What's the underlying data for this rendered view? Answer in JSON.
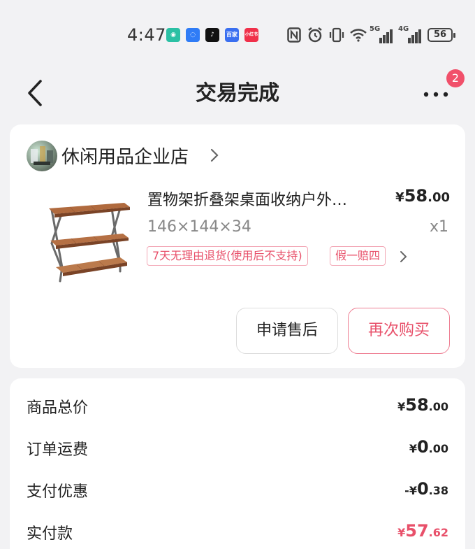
{
  "status_bar": {
    "time": "4:47",
    "apps": [
      {
        "name": "xiaomi-app-icon",
        "bg": "#2bc0a4",
        "text": "◉"
      },
      {
        "name": "bulb-app-icon",
        "bg": "#2f7cf6",
        "text": "◌"
      },
      {
        "name": "tiktok-app-icon",
        "bg": "#111111",
        "text": "♪"
      },
      {
        "name": "pinduoduo-app-icon",
        "bg": "#3a6ff0",
        "text": "百家"
      },
      {
        "name": "xiaohongshu-app-icon",
        "bg": "#f0304a",
        "text": "小红书"
      }
    ],
    "network_5g": "5G",
    "network_4g": "4G",
    "battery": "56"
  },
  "header": {
    "title": "交易完成",
    "badge_count": "2"
  },
  "store": {
    "name": "休闲用品企业店"
  },
  "product": {
    "title": "置物架折叠架桌面收纳户外…",
    "price_symbol": "¥",
    "price_int": "58",
    "price_dec": ".00",
    "spec": "146×144×34",
    "qty": "x1",
    "tags": [
      "7天无理由退货(使用后不支持)",
      "假一赔四"
    ]
  },
  "actions": {
    "after_sale": "申请售后",
    "rebuy": "再次购买"
  },
  "summary": {
    "rows": [
      {
        "label": "商品总价",
        "sign": "",
        "cur": "¥",
        "int": "58",
        "dec": ".00"
      },
      {
        "label": "订单运费",
        "sign": "",
        "cur": "¥",
        "int": "0",
        "dec": ".00"
      },
      {
        "label": "支付优惠",
        "sign": "-",
        "cur": "¥",
        "int": "0",
        "dec": ".38"
      },
      {
        "label": "实付款",
        "sign": "",
        "cur": "¥",
        "int": "57",
        "dec": ".62"
      }
    ]
  },
  "colors": {
    "accent": "#e8506a",
    "background": "#f2f2f4"
  }
}
